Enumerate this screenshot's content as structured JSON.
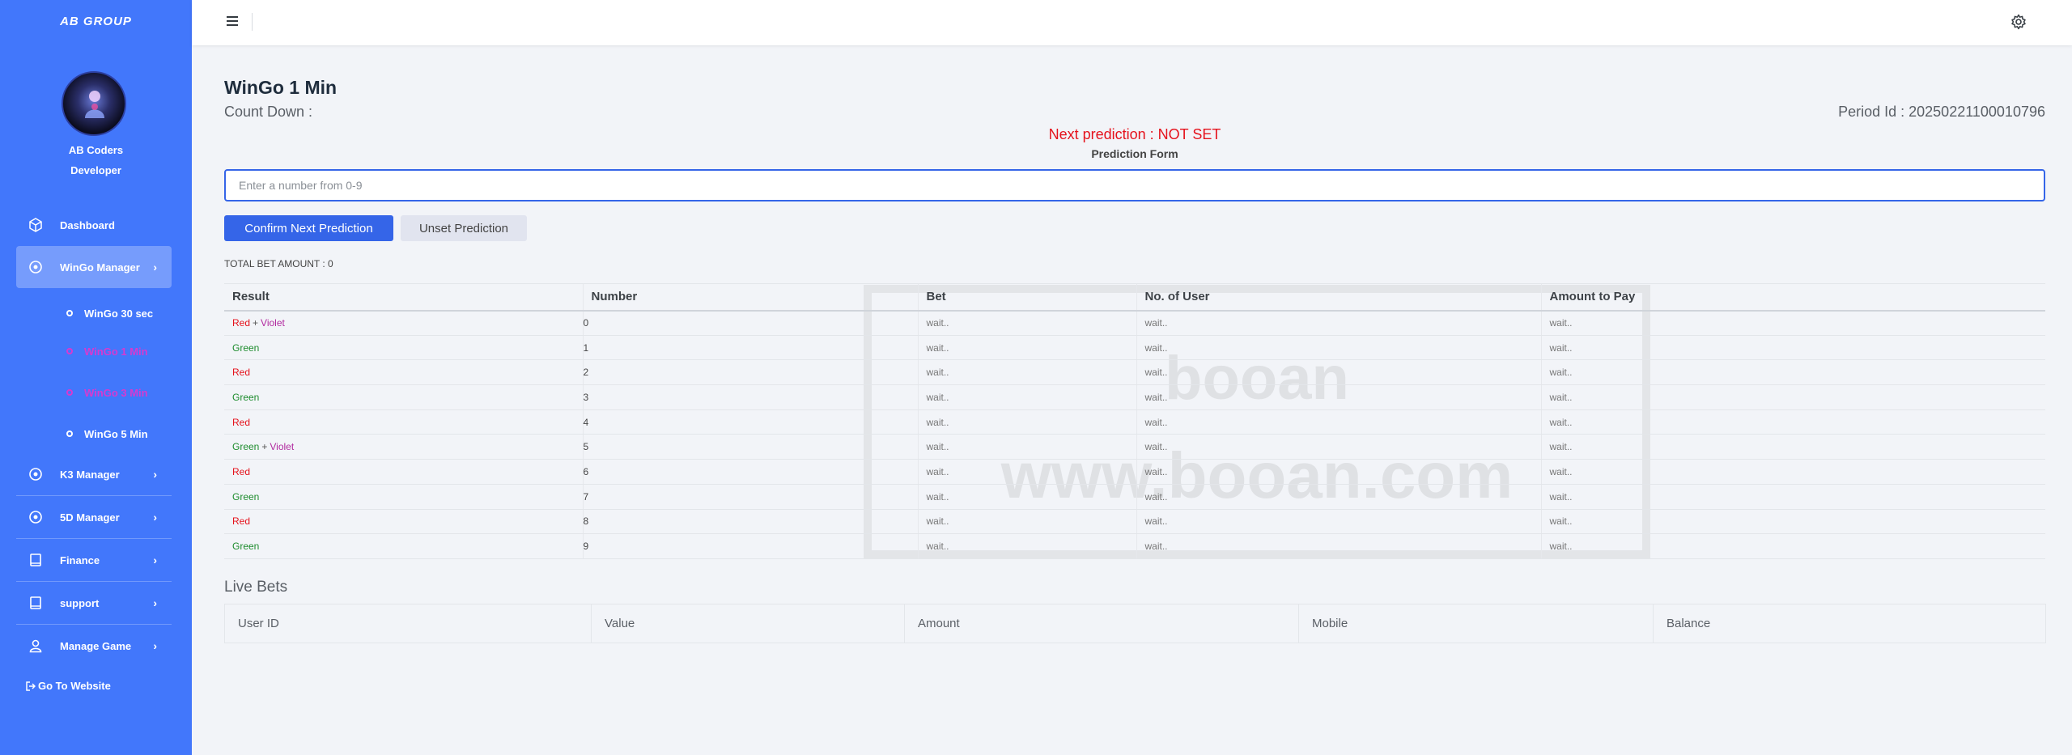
{
  "sidebar": {
    "brand": "AB GROUP",
    "user_name": "AB Coders",
    "user_role": "Developer",
    "items": [
      {
        "label": "Dashboard"
      },
      {
        "label": "WinGo Manager"
      },
      {
        "label": "K3 Manager"
      },
      {
        "label": "5D Manager"
      },
      {
        "label": "Finance"
      },
      {
        "label": "support"
      },
      {
        "label": "Manage Game"
      }
    ],
    "sub_items": [
      {
        "label": "WinGo 30 sec"
      },
      {
        "label": "WinGo 1 Min"
      },
      {
        "label": "WinGo 3 Min"
      },
      {
        "label": "WinGo 5 Min"
      }
    ],
    "goto_label": "Go To Website"
  },
  "page": {
    "title": "WinGo 1 Min",
    "countdown_label": "Count Down :",
    "period_label": "Period Id : 20250221100010796",
    "next_prediction": "Next prediction : NOT SET",
    "form_label": "Prediction Form",
    "input_placeholder": "Enter a number from 0-9",
    "confirm_button": "Confirm Next Prediction",
    "unset_button": "Unset Prediction",
    "total_bet": "TOTAL BET AMOUNT : 0"
  },
  "prediction_table": {
    "headers": [
      "Result",
      "Number",
      "Bet",
      "No. of User",
      "Amount to Pay"
    ],
    "rows": [
      {
        "result": [
          "Red",
          "Violet"
        ],
        "number": "0",
        "bet": "wait..",
        "users": "wait..",
        "pay": "wait.."
      },
      {
        "result": [
          "Green"
        ],
        "number": "1",
        "bet": "wait..",
        "users": "wait..",
        "pay": "wait.."
      },
      {
        "result": [
          "Red"
        ],
        "number": "2",
        "bet": "wait..",
        "users": "wait..",
        "pay": "wait.."
      },
      {
        "result": [
          "Green"
        ],
        "number": "3",
        "bet": "wait..",
        "users": "wait..",
        "pay": "wait.."
      },
      {
        "result": [
          "Red"
        ],
        "number": "4",
        "bet": "wait..",
        "users": "wait..",
        "pay": "wait.."
      },
      {
        "result": [
          "Green",
          "Violet"
        ],
        "number": "5",
        "bet": "wait..",
        "users": "wait..",
        "pay": "wait.."
      },
      {
        "result": [
          "Red"
        ],
        "number": "6",
        "bet": "wait..",
        "users": "wait..",
        "pay": "wait.."
      },
      {
        "result": [
          "Green"
        ],
        "number": "7",
        "bet": "wait..",
        "users": "wait..",
        "pay": "wait.."
      },
      {
        "result": [
          "Red"
        ],
        "number": "8",
        "bet": "wait..",
        "users": "wait..",
        "pay": "wait.."
      },
      {
        "result": [
          "Green"
        ],
        "number": "9",
        "bet": "wait..",
        "users": "wait..",
        "pay": "wait.."
      }
    ],
    "plus_sign": "+"
  },
  "live_bets": {
    "title": "Live Bets",
    "headers": [
      "User ID",
      "Value",
      "Amount",
      "Mobile",
      "Balance"
    ]
  },
  "watermark": {
    "line1": "booan",
    "line2": "www.booan.com"
  },
  "colors": {
    "sidebar": "#4277fb",
    "primary": "#3565e8",
    "red": "#e5121c",
    "green": "#1e8c2e",
    "violet": "#b12a9f"
  }
}
